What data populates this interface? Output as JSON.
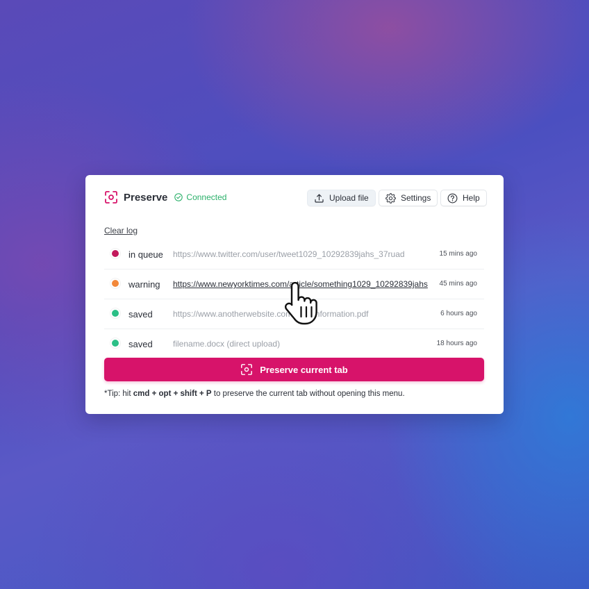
{
  "app": {
    "name": "Preserve",
    "connection_status": "Connected"
  },
  "toolbar": {
    "upload_label": "Upload file",
    "settings_label": "Settings",
    "help_label": "Help"
  },
  "log": {
    "clear_label": "Clear log",
    "items": [
      {
        "status": "in queue",
        "status_color": "#c2185b",
        "url": "https://www.twitter.com/user/tweet1029_10292839jahs_37ruad",
        "time": "15 mins ago"
      },
      {
        "status": "warning",
        "status_color": "#f2883a",
        "url": "https://www.newyorktimes.com/article/something1029_10292839jahs",
        "time": "45 mins ago"
      },
      {
        "status": "saved",
        "status_color": "#2bbf86",
        "url": "https://www.anotherwebsite.com/path/information.pdf",
        "time": "6 hours ago"
      },
      {
        "status": "saved",
        "status_color": "#2bbf86",
        "url": "filename.docx (direct upload)",
        "time": "18 hours ago"
      }
    ]
  },
  "primary_action": {
    "label": "Preserve current tab"
  },
  "tip": {
    "prefix": "*Tip: hit ",
    "shortcut": "cmd + opt + shift + P",
    "suffix": " to preserve the current tab without opening this menu."
  },
  "colors": {
    "brand": "#d7136a",
    "connected": "#2bb06a"
  },
  "icons": {
    "brand": "focus-frame-icon",
    "connected": "check-circle-icon",
    "upload": "upload-icon",
    "settings": "gear-icon",
    "help": "question-circle-icon",
    "cursor": "hand-pointer-icon"
  }
}
